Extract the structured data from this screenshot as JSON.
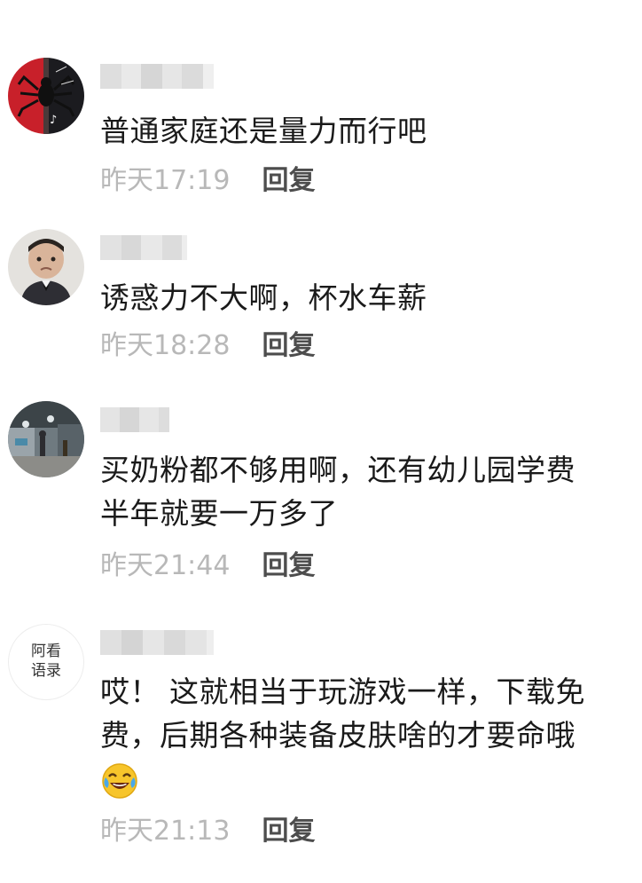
{
  "comments": [
    {
      "avatar_icon": "spiderman-tiktok-avatar-icon",
      "text": "普通家庭还是量力而行吧",
      "time": "昨天17:19",
      "reply_label": "回复"
    },
    {
      "avatar_icon": "child-photo-avatar-icon",
      "text": "诱惑力不大啊，杯水车薪",
      "time": "昨天18:28",
      "reply_label": "回复"
    },
    {
      "avatar_icon": "street-photo-avatar-icon",
      "text_line1": "买奶粉都不够用啊，还有幼儿园学费",
      "text_line2": "半年就要一万多了",
      "time": "昨天21:44",
      "reply_label": "回复"
    },
    {
      "avatar_icon": "text-logo-avatar-icon",
      "avatar_text_top": "阿看",
      "avatar_text_bottom": "语录",
      "text_line1": "哎！ 这就相当于玩游戏一样，下载免",
      "text_line2": "费，后期各种装备皮肤啥的才要命哦",
      "emoji_icon": "laughing-tears-emoji-icon",
      "time": "昨天21:13",
      "reply_label": "回复"
    }
  ],
  "colors": {
    "text": "#1a1a1a",
    "time": "#b8b8b8",
    "reply": "#4d4d4d"
  }
}
